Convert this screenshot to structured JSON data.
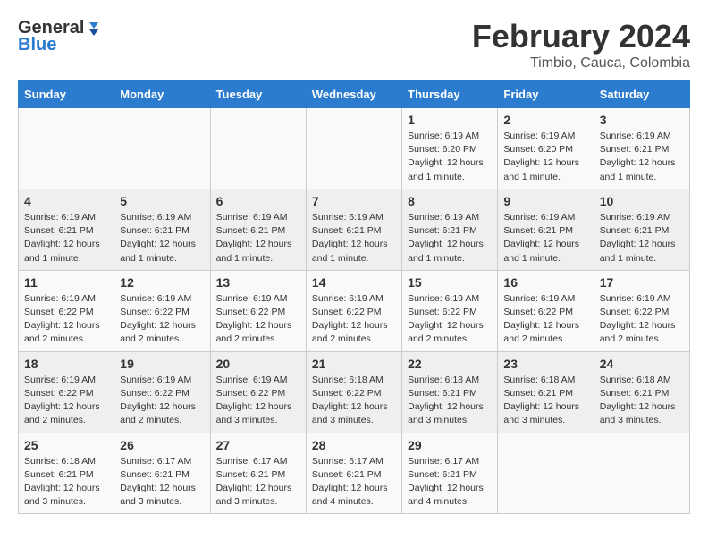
{
  "logo": {
    "text_general": "General",
    "text_blue": "Blue"
  },
  "title": "February 2024",
  "subtitle": "Timbio, Cauca, Colombia",
  "days_of_week": [
    "Sunday",
    "Monday",
    "Tuesday",
    "Wednesday",
    "Thursday",
    "Friday",
    "Saturday"
  ],
  "weeks": [
    [
      {
        "day": "",
        "info": ""
      },
      {
        "day": "",
        "info": ""
      },
      {
        "day": "",
        "info": ""
      },
      {
        "day": "",
        "info": ""
      },
      {
        "day": "1",
        "info": "Sunrise: 6:19 AM\nSunset: 6:20 PM\nDaylight: 12 hours\nand 1 minute."
      },
      {
        "day": "2",
        "info": "Sunrise: 6:19 AM\nSunset: 6:20 PM\nDaylight: 12 hours\nand 1 minute."
      },
      {
        "day": "3",
        "info": "Sunrise: 6:19 AM\nSunset: 6:21 PM\nDaylight: 12 hours\nand 1 minute."
      }
    ],
    [
      {
        "day": "4",
        "info": "Sunrise: 6:19 AM\nSunset: 6:21 PM\nDaylight: 12 hours\nand 1 minute."
      },
      {
        "day": "5",
        "info": "Sunrise: 6:19 AM\nSunset: 6:21 PM\nDaylight: 12 hours\nand 1 minute."
      },
      {
        "day": "6",
        "info": "Sunrise: 6:19 AM\nSunset: 6:21 PM\nDaylight: 12 hours\nand 1 minute."
      },
      {
        "day": "7",
        "info": "Sunrise: 6:19 AM\nSunset: 6:21 PM\nDaylight: 12 hours\nand 1 minute."
      },
      {
        "day": "8",
        "info": "Sunrise: 6:19 AM\nSunset: 6:21 PM\nDaylight: 12 hours\nand 1 minute."
      },
      {
        "day": "9",
        "info": "Sunrise: 6:19 AM\nSunset: 6:21 PM\nDaylight: 12 hours\nand 1 minute."
      },
      {
        "day": "10",
        "info": "Sunrise: 6:19 AM\nSunset: 6:21 PM\nDaylight: 12 hours\nand 1 minute."
      }
    ],
    [
      {
        "day": "11",
        "info": "Sunrise: 6:19 AM\nSunset: 6:22 PM\nDaylight: 12 hours\nand 2 minutes."
      },
      {
        "day": "12",
        "info": "Sunrise: 6:19 AM\nSunset: 6:22 PM\nDaylight: 12 hours\nand 2 minutes."
      },
      {
        "day": "13",
        "info": "Sunrise: 6:19 AM\nSunset: 6:22 PM\nDaylight: 12 hours\nand 2 minutes."
      },
      {
        "day": "14",
        "info": "Sunrise: 6:19 AM\nSunset: 6:22 PM\nDaylight: 12 hours\nand 2 minutes."
      },
      {
        "day": "15",
        "info": "Sunrise: 6:19 AM\nSunset: 6:22 PM\nDaylight: 12 hours\nand 2 minutes."
      },
      {
        "day": "16",
        "info": "Sunrise: 6:19 AM\nSunset: 6:22 PM\nDaylight: 12 hours\nand 2 minutes."
      },
      {
        "day": "17",
        "info": "Sunrise: 6:19 AM\nSunset: 6:22 PM\nDaylight: 12 hours\nand 2 minutes."
      }
    ],
    [
      {
        "day": "18",
        "info": "Sunrise: 6:19 AM\nSunset: 6:22 PM\nDaylight: 12 hours\nand 2 minutes."
      },
      {
        "day": "19",
        "info": "Sunrise: 6:19 AM\nSunset: 6:22 PM\nDaylight: 12 hours\nand 2 minutes."
      },
      {
        "day": "20",
        "info": "Sunrise: 6:19 AM\nSunset: 6:22 PM\nDaylight: 12 hours\nand 3 minutes."
      },
      {
        "day": "21",
        "info": "Sunrise: 6:18 AM\nSunset: 6:22 PM\nDaylight: 12 hours\nand 3 minutes."
      },
      {
        "day": "22",
        "info": "Sunrise: 6:18 AM\nSunset: 6:21 PM\nDaylight: 12 hours\nand 3 minutes."
      },
      {
        "day": "23",
        "info": "Sunrise: 6:18 AM\nSunset: 6:21 PM\nDaylight: 12 hours\nand 3 minutes."
      },
      {
        "day": "24",
        "info": "Sunrise: 6:18 AM\nSunset: 6:21 PM\nDaylight: 12 hours\nand 3 minutes."
      }
    ],
    [
      {
        "day": "25",
        "info": "Sunrise: 6:18 AM\nSunset: 6:21 PM\nDaylight: 12 hours\nand 3 minutes."
      },
      {
        "day": "26",
        "info": "Sunrise: 6:17 AM\nSunset: 6:21 PM\nDaylight: 12 hours\nand 3 minutes."
      },
      {
        "day": "27",
        "info": "Sunrise: 6:17 AM\nSunset: 6:21 PM\nDaylight: 12 hours\nand 3 minutes."
      },
      {
        "day": "28",
        "info": "Sunrise: 6:17 AM\nSunset: 6:21 PM\nDaylight: 12 hours\nand 4 minutes."
      },
      {
        "day": "29",
        "info": "Sunrise: 6:17 AM\nSunset: 6:21 PM\nDaylight: 12 hours\nand 4 minutes."
      },
      {
        "day": "",
        "info": ""
      },
      {
        "day": "",
        "info": ""
      }
    ]
  ]
}
